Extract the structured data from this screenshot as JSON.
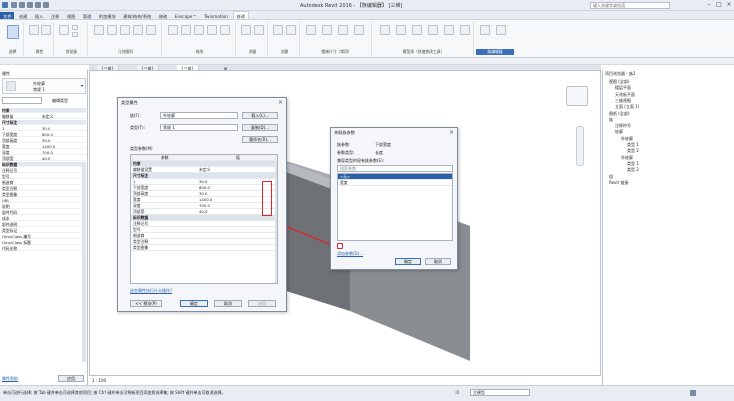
{
  "app": {
    "title": "Autodesk Revit 2016 - 【族编辑器】 [三维]",
    "search_placeholder": "键入关键字或短语"
  },
  "ribbon_tabs": [
    "文件",
    "创建",
    "插入",
    "注释",
    "视图",
    "管理",
    "附加模块",
    "建筑/结构/系统",
    "修改",
    "Enscape™",
    "Twinmotion",
    "修改"
  ],
  "ribbon": {
    "groups": [
      "选择",
      "属性",
      "剪贴板",
      "几何图形",
      "修改",
      "测量",
      "创建",
      "楼梯尺寸（常用）",
      "模型线（快速修改工具）",
      "族编辑器"
    ]
  },
  "doc_tabs": [
    "{三维}",
    "{三维}",
    "{三维}"
  ],
  "properties": {
    "title": "属性",
    "type_name": "外轮廓",
    "type_sub": "常规 1",
    "edit_type": "编辑类型",
    "rows": [
      {
        "k": "约束",
        "v": "",
        "sec": true
      },
      {
        "k": "偏移量",
        "v": "未定义"
      },
      {
        "k": "尺寸标注",
        "v": "",
        "sec": true
      },
      {
        "k": "1",
        "v": "30.0"
      },
      {
        "k": "下部宽度",
        "v": "800.0"
      },
      {
        "k": "顶部高度",
        "v": "30.0"
      },
      {
        "k": "宽度",
        "v": "1400.0"
      },
      {
        "k": "深度",
        "v": "700.0"
      },
      {
        "k": "顶部宽",
        "v": "40.0"
      },
      {
        "k": "标识数据",
        "v": "",
        "sec": true
      },
      {
        "k": "注释记号",
        "v": ""
      },
      {
        "k": "型号",
        "v": ""
      },
      {
        "k": "制造商",
        "v": ""
      },
      {
        "k": "类型注释",
        "v": ""
      },
      {
        "k": "类型图像",
        "v": ""
      },
      {
        "k": "URL",
        "v": ""
      },
      {
        "k": "说明",
        "v": ""
      },
      {
        "k": "部件代码",
        "v": ""
      },
      {
        "k": "成本",
        "v": ""
      },
      {
        "k": "部件说明",
        "v": ""
      },
      {
        "k": "类型标记",
        "v": ""
      },
      {
        "k": "OmniClass 编号",
        "v": ""
      },
      {
        "k": "OmniClass 标题",
        "v": ""
      },
      {
        "k": "代码名称",
        "v": ""
      }
    ],
    "help_link": "属性帮助",
    "apply": "应用"
  },
  "type_dialog": {
    "title": "类型属性",
    "family_label": "族(F):",
    "family_value": "外轮廓",
    "type_label": "类型(T):",
    "type_value": "常规 1",
    "load_btn": "载入(L)...",
    "dup_btn": "复制(D)...",
    "rename_btn": "重命名(R)...",
    "params_label": "类型参数(M)",
    "col_param": "参数",
    "col_value": "值",
    "rows": [
      {
        "k": "约束",
        "v": "",
        "sec": true
      },
      {
        "k": "偏移量设置",
        "v": "未定义"
      },
      {
        "k": "尺寸标注",
        "v": "",
        "sec": true
      },
      {
        "k": "1",
        "v": "30.0"
      },
      {
        "k": "下部宽度",
        "v": "800.0"
      },
      {
        "k": "顶部高度",
        "v": "30.0"
      },
      {
        "k": "宽度",
        "v": "1400.0"
      },
      {
        "k": "深度",
        "v": "700.0"
      },
      {
        "k": "顶部宽",
        "v": "40.0"
      },
      {
        "k": "标识数据",
        "v": "",
        "sec": true
      },
      {
        "k": "注释记号",
        "v": ""
      },
      {
        "k": "型号",
        "v": ""
      },
      {
        "k": "制造商",
        "v": ""
      },
      {
        "k": "类型注释",
        "v": ""
      },
      {
        "k": "类型图像",
        "v": ""
      }
    ],
    "link": "这些属性执行什么操作?",
    "preview_btn": "<< 预览(P)",
    "ok": "确定",
    "cancel": "取消",
    "apply": "应用"
  },
  "assoc_dialog": {
    "title": "关联族参数",
    "family_param_label": "族参数:",
    "family_param_value": "下部宽度",
    "param_type_label": "参数类型:",
    "param_type_value": "长度",
    "compat_label": "兼容类型的现有族参数(E):",
    "search_placeholder": "搜索参数",
    "list": [
      "<无>",
      "宽度"
    ],
    "add_param_link": "添加参数(D)...",
    "ok": "确定",
    "cancel": "取消"
  },
  "browser": {
    "title": "项目浏览器 - 族2",
    "items": [
      {
        "t": "视图 (全部)",
        "lvl": 0
      },
      {
        "t": "楼层平面",
        "lvl": 1
      },
      {
        "t": "天花板平面",
        "lvl": 1
      },
      {
        "t": "三维视图",
        "lvl": 1
      },
      {
        "t": "立面 (立面 1)",
        "lvl": 1
      },
      {
        "t": "图纸 (全部)",
        "lvl": 0
      },
      {
        "t": "族",
        "lvl": 0
      },
      {
        "t": "注释符号",
        "lvl": 1
      },
      {
        "t": "轮廓",
        "lvl": 1
      },
      {
        "t": "外轮廓",
        "lvl": 2
      },
      {
        "t": "类型 1",
        "lvl": 3
      },
      {
        "t": "类型 2",
        "lvl": 3
      },
      {
        "t": "外轮廓",
        "lvl": 2
      },
      {
        "t": "类型 1",
        "lvl": 3
      },
      {
        "t": "类型 2",
        "lvl": 3
      },
      {
        "t": "组",
        "lvl": 0
      },
      {
        "t": "Revit 链接",
        "lvl": 0
      }
    ]
  },
  "status": {
    "left": "单击可进行选择; 按 Tab 键并单击可选择其他项目; 按 Ctrl 键并单击可将新项目添加到选择集; 按 Shift 键并单击可取消选择。",
    "scale": "1 : 100",
    "main_model": "主模型",
    "zero": ":0"
  },
  "colors": {
    "accent": "#2b5fa8",
    "annotation_red": "#d9262c"
  }
}
